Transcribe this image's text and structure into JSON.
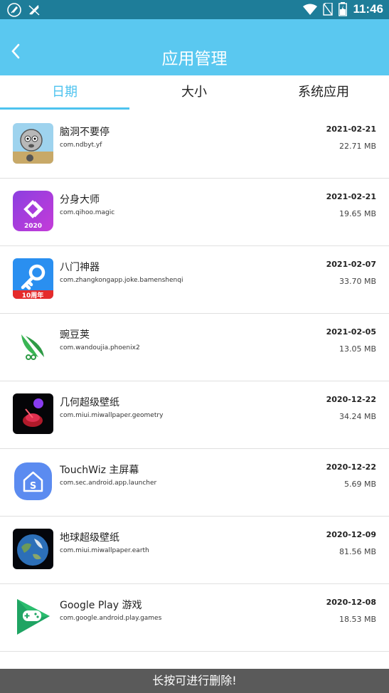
{
  "status_bar": {
    "time": "11:46",
    "icons": [
      "rocket-icon",
      "no-signal-icon",
      "wifi-icon",
      "sim-off-icon",
      "battery-charging-icon"
    ]
  },
  "header": {
    "title": "应用管理"
  },
  "tabs": [
    {
      "label": "日期",
      "active": true
    },
    {
      "label": "大小",
      "active": false
    },
    {
      "label": "系统应用",
      "active": false
    }
  ],
  "apps": [
    {
      "name": "脑洞不要停",
      "package": "com.ndbyt.yf",
      "date": "2021-02-21",
      "size": "22.71 MB",
      "icon": "cartoon-face-icon"
    },
    {
      "name": "分身大师",
      "package": "com.qihoo.magic",
      "date": "2021-02-21",
      "size": "19.65 MB",
      "icon": "clone-2020-icon"
    },
    {
      "name": "八门神器",
      "package": "com.zhangkongapp.joke.bamenshenqi",
      "date": "2021-02-07",
      "size": "33.70 MB",
      "icon": "key-10th-anniversary-icon"
    },
    {
      "name": "豌豆荚",
      "package": "com.wandoujia.phoenix2",
      "date": "2021-02-05",
      "size": "13.05 MB",
      "icon": "pea-pod-icon"
    },
    {
      "name": "几何超级壁纸",
      "package": "com.miui.miwallpaper.geometry",
      "date": "2020-12-22",
      "size": "34.24 MB",
      "icon": "geometry-wallpaper-icon"
    },
    {
      "name": "TouchWiz 主屏幕",
      "package": "com.sec.android.app.launcher",
      "date": "2020-12-22",
      "size": "5.69 MB",
      "icon": "home-launcher-icon"
    },
    {
      "name": "地球超级壁纸",
      "package": "com.miui.miwallpaper.earth",
      "date": "2020-12-09",
      "size": "81.56 MB",
      "icon": "earth-icon"
    },
    {
      "name": "Google Play 游戏",
      "package": "com.google.android.play.games",
      "date": "2020-12-08",
      "size": "18.53 MB",
      "icon": "play-games-icon"
    }
  ],
  "toast": "长按可进行删除!",
  "colors": {
    "status_bar": "#1e7d99",
    "header": "#5ac8f0",
    "accent": "#4ec3ef"
  }
}
